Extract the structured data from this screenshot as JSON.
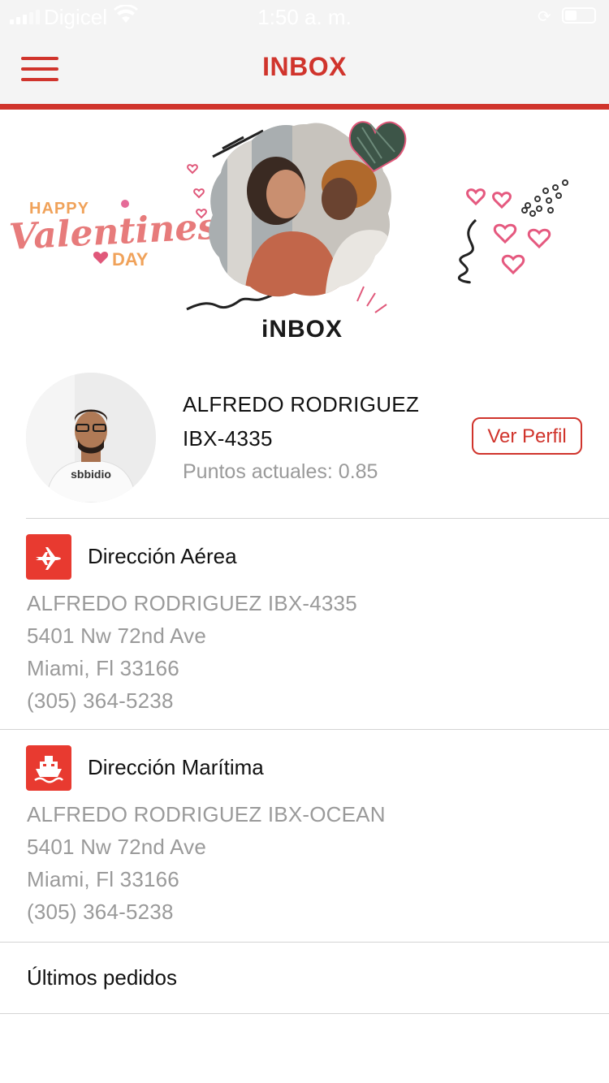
{
  "status_bar": {
    "carrier": "Digicel",
    "time": "1:50 a. m."
  },
  "nav": {
    "title": "INBOX",
    "menu_icon": "hamburger-menu-icon"
  },
  "banner": {
    "happy": "HAPPY",
    "valentines": "Valentines",
    "day": "DAY",
    "logo_text": "iNBOX"
  },
  "profile": {
    "name": "ALFREDO RODRIGUEZ",
    "code": "IBX-4335",
    "points_label": "Puntos actuales: 0.85",
    "ver_perfil_label": "Ver Perfil"
  },
  "addresses": {
    "air": {
      "icon": "airplane-icon",
      "title": "Dirección Aérea",
      "line1": "ALFREDO RODRIGUEZ IBX-4335",
      "line2": "5401 Nw 72nd Ave",
      "line3": "Miami, Fl 33166",
      "line4": "(305) 364-5238"
    },
    "sea": {
      "icon": "ship-icon",
      "title": "Dirección Marítima",
      "line1": "ALFREDO RODRIGUEZ IBX-OCEAN",
      "line2": "5401 Nw 72nd Ave",
      "line3": "Miami, Fl 33166",
      "line4": "(305) 364-5238"
    }
  },
  "orders": {
    "label": "Últimos pedidos"
  },
  "colors": {
    "accent": "#d0342c",
    "icon_bg": "#e83a30",
    "secondary_text": "#9a9a9a",
    "divider": "#d4d4d4"
  }
}
